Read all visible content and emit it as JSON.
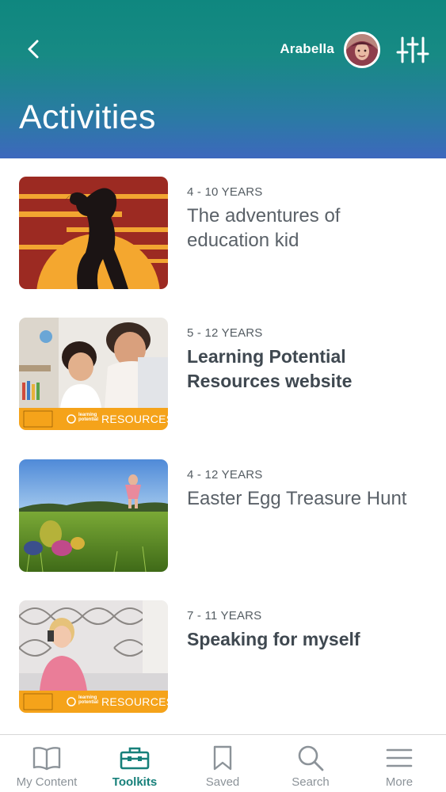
{
  "header": {
    "user_name": "Arabella",
    "title": "Activities"
  },
  "activities": [
    {
      "age": "4 - 10 YEARS",
      "title": "The adventures of education kid"
    },
    {
      "age": "5 - 12 YEARS",
      "title": "Learning Potential Resources website",
      "badge": "RESOURCES",
      "badge_brand": "learning potential"
    },
    {
      "age": "4 - 12 YEARS",
      "title": "Easter Egg Treasure Hunt"
    },
    {
      "age": "7 - 11 YEARS",
      "title": "Speaking for myself",
      "badge": "RESOURCES",
      "badge_brand": "learning potential"
    }
  ],
  "tabs": [
    {
      "label": "My Content",
      "icon": "book-icon"
    },
    {
      "label": "Toolkits",
      "icon": "toolbox-icon",
      "active": true
    },
    {
      "label": "Saved",
      "icon": "bookmark-icon"
    },
    {
      "label": "Search",
      "icon": "search-icon"
    },
    {
      "label": "More",
      "icon": "menu-icon"
    }
  ],
  "colors": {
    "header_top": "#0f877f",
    "header_bottom": "#3d68bd",
    "active_tab": "#17807a",
    "badge": "#f5a31a"
  }
}
